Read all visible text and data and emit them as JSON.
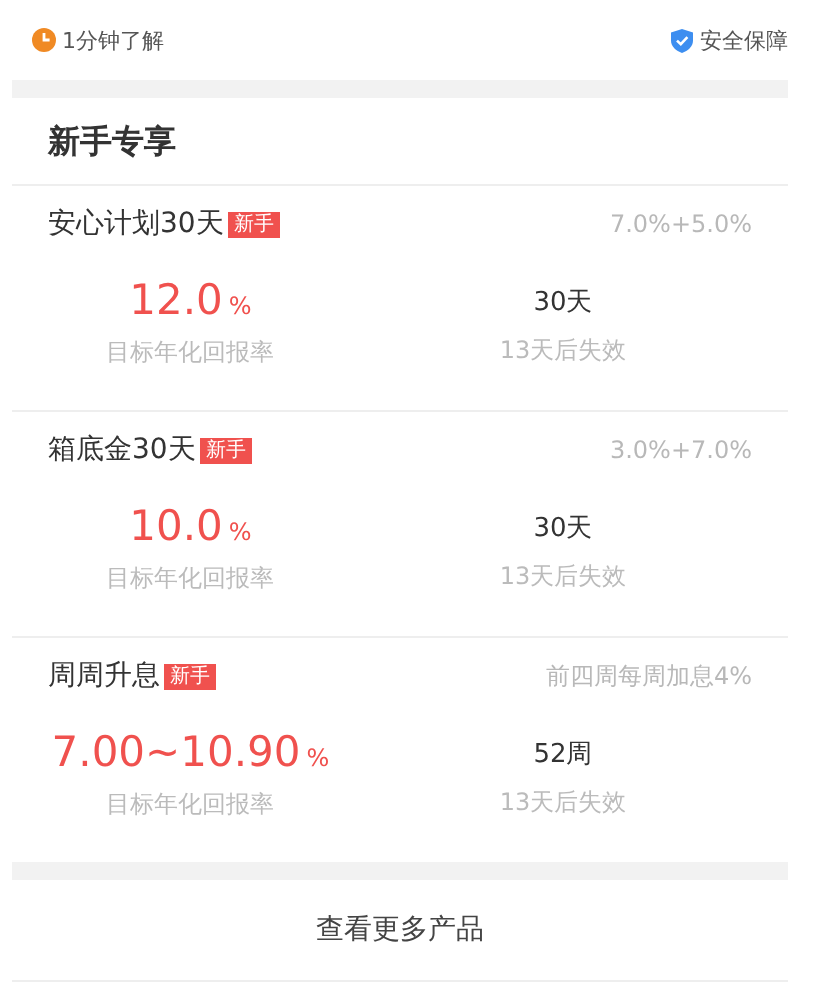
{
  "top_bar": {
    "left_link": "1分钟了解",
    "right_link": "安全保障"
  },
  "section": {
    "title": "新手专享"
  },
  "products": [
    {
      "name": "安心计划30天",
      "badge": "新手",
      "bonus": "7.0%+5.0%",
      "rate": "12.0",
      "rate_unit": "%",
      "rate_label": "目标年化回报率",
      "term": "30天",
      "expiry": "13天后失效"
    },
    {
      "name": "箱底金30天",
      "badge": "新手",
      "bonus": "3.0%+7.0%",
      "rate": "10.0",
      "rate_unit": "%",
      "rate_label": "目标年化回报率",
      "term": "30天",
      "expiry": "13天后失效"
    },
    {
      "name": "周周升息",
      "badge": "新手",
      "bonus": "前四周每周加息4%",
      "rate": "7.00~10.90",
      "rate_unit": "%",
      "rate_label": "目标年化回报率",
      "term": "52周",
      "expiry": "13天后失效"
    }
  ],
  "more_button": "查看更多产品"
}
